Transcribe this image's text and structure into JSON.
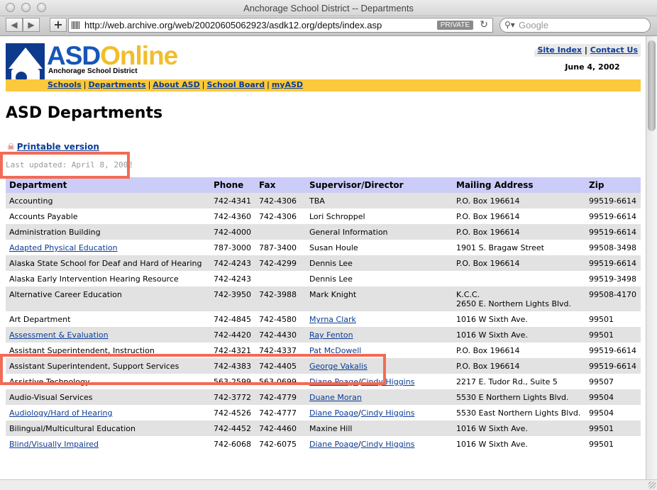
{
  "window": {
    "title": "Anchorage School District -- Departments"
  },
  "toolbar": {
    "url": "http://web.archive.org/web/20020605062923/asdk12.org/depts/index.asp",
    "private_label": "PRIVATE",
    "search_placeholder": "Google"
  },
  "header": {
    "brand_asd": "ASD",
    "brand_online": "Online",
    "district": "Anchorage School District",
    "site_index": "Site Index",
    "contact_us": "Contact Us",
    "date": "June 4, 2002",
    "nav": {
      "schools": "Schools",
      "departments": "Departments",
      "about": "About ASD",
      "board": "School Board",
      "myasd": "myASD",
      "sep": "|"
    }
  },
  "main": {
    "title": "ASD Departments",
    "printable": "Printable version",
    "last_updated": "Last updated: April 8, 2002"
  },
  "table": {
    "headers": [
      "Department",
      "Phone",
      "Fax",
      "Supervisor/Director",
      "Mailing Address",
      "Zip"
    ],
    "rows": [
      {
        "dept": "Accounting",
        "dept_link": false,
        "phone": "742-4341",
        "fax": "742-4306",
        "sup": [
          "TBA"
        ],
        "sup_link": false,
        "addr": "P.O. Box 196614",
        "zip": "99519-6614"
      },
      {
        "dept": "Accounts Payable",
        "dept_link": false,
        "phone": "742-4360",
        "fax": "742-4306",
        "sup": [
          "Lori Schroppel"
        ],
        "sup_link": false,
        "addr": "P.O. Box 196614",
        "zip": "99519-6614"
      },
      {
        "dept": "Administration Building",
        "dept_link": false,
        "phone": "742-4000",
        "fax": "",
        "sup": [
          "General Information"
        ],
        "sup_link": false,
        "addr": "P.O. Box 196614",
        "zip": "99519-6614"
      },
      {
        "dept": "Adapted Physical Education",
        "dept_link": true,
        "phone": "787-3000",
        "fax": "787-3400",
        "sup": [
          "Susan Houle"
        ],
        "sup_link": false,
        "addr": "1901 S. Bragaw Street",
        "zip": "99508-3498"
      },
      {
        "dept": "Alaska State School for Deaf and Hard of Hearing",
        "dept_link": false,
        "phone": "742-4243",
        "fax": "742-4299",
        "sup": [
          "Dennis Lee"
        ],
        "sup_link": false,
        "addr": "P.O. Box 196614",
        "zip": "99519-6614"
      },
      {
        "dept": "Alaska Early Intervention Hearing Resource",
        "dept_link": false,
        "phone": "742-4243",
        "fax": "",
        "sup": [
          "Dennis Lee"
        ],
        "sup_link": false,
        "addr": "",
        "zip": "99519-3498"
      },
      {
        "dept": "Alternative Career Education",
        "dept_link": false,
        "phone": "742-3950",
        "fax": "742-3988",
        "sup": [
          "Mark Knight"
        ],
        "sup_link": false,
        "addr": "K.C.C.\n2650 E. Northern Lights Blvd.",
        "zip": "99508-4170"
      },
      {
        "dept": "Art Department",
        "dept_link": false,
        "phone": "742-4845",
        "fax": "742-4580",
        "sup": [
          "Myrna Clark"
        ],
        "sup_link": true,
        "addr": "1016 W Sixth Ave.",
        "zip": "99501"
      },
      {
        "dept": "Assessment & Evaluation",
        "dept_link": true,
        "phone": "742-4420",
        "fax": "742-4430",
        "sup": [
          "Ray Fenton"
        ],
        "sup_link": true,
        "addr": "1016 W Sixth Ave.",
        "zip": "99501"
      },
      {
        "dept": "Assistant Superintendent, Instruction",
        "dept_link": false,
        "phone": "742-4321",
        "fax": "742-4337",
        "sup": [
          "Pat McDowell"
        ],
        "sup_link": true,
        "addr": "P.O. Box 196614",
        "zip": "99519-6614"
      },
      {
        "dept": "Assistant Superintendent, Support Services",
        "dept_link": false,
        "phone": "742-4383",
        "fax": "742-4405",
        "sup": [
          "George Vakalis"
        ],
        "sup_link": true,
        "addr": "P.O. Box 196614",
        "zip": "99519-6614"
      },
      {
        "dept": "Assistive Technology",
        "dept_link": false,
        "phone": "563-2599",
        "fax": "563-0699",
        "sup": [
          "Diane Poage",
          "Cindy Higgins"
        ],
        "sup_link": true,
        "addr": "2217 E. Tudor Rd., Suite 5",
        "zip": "99507"
      },
      {
        "dept": "Audio-Visual Services",
        "dept_link": false,
        "phone": "742-3772",
        "fax": "742-4779",
        "sup": [
          "Duane Moran"
        ],
        "sup_link": true,
        "addr": "5530 E Northern Lights Blvd.",
        "zip": "99504"
      },
      {
        "dept": "Audiology/Hard of Hearing",
        "dept_link": true,
        "phone": "742-4526",
        "fax": "742-4777",
        "sup": [
          "Diane Poage",
          "Cindy Higgins"
        ],
        "sup_link": true,
        "addr": "5530 East Northern Lights Blvd.",
        "zip": "99504"
      },
      {
        "dept": "Bilingual/Multicultural Education",
        "dept_link": false,
        "phone": "742-4452",
        "fax": "742-4460",
        "sup": [
          "Maxine Hill"
        ],
        "sup_link": false,
        "addr": "1016 W Sixth Ave.",
        "zip": "99501"
      },
      {
        "dept": "Blind/Visually Impaired",
        "dept_link": true,
        "phone": "742-6068",
        "fax": "742-6075",
        "sup": [
          "Diane Poage",
          "Cindy Higgins"
        ],
        "sup_link": true,
        "addr": "1016 W Sixth Ave.",
        "zip": "99501"
      }
    ]
  }
}
